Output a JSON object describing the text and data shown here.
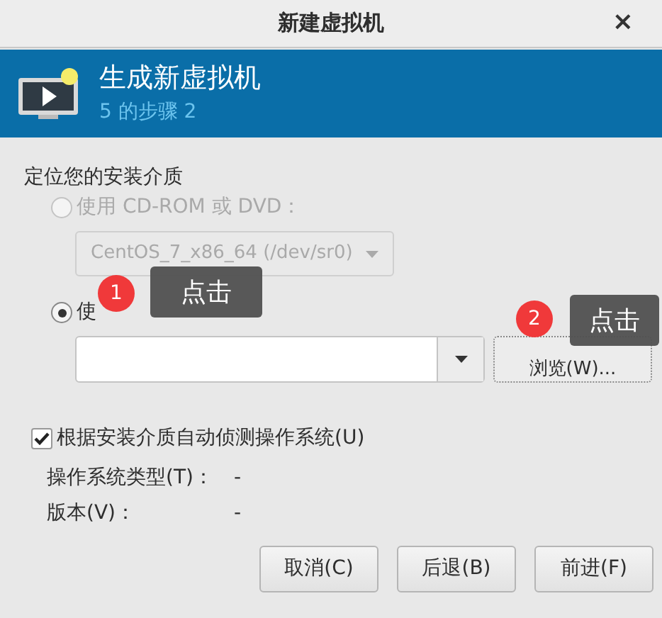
{
  "window": {
    "title": "新建虚拟机",
    "close": "×"
  },
  "header": {
    "title": "生成新虚拟机",
    "subtitle": "5 的步骤 2"
  },
  "section_label": "定位您的安装介质",
  "options": [
    {
      "label": "使用  CD-ROM 或  DVD：",
      "selected": false,
      "disabled": true,
      "kind": "dropdown",
      "value": "CentOS_7_x86_64 (/dev/sr0)"
    },
    {
      "label": "使",
      "selected": true,
      "disabled": false,
      "kind": "combo",
      "button": "浏览(W)..."
    }
  ],
  "autodetect": {
    "label": "根据安装介质自动侦测操作系统(U)",
    "checked": true
  },
  "info": [
    {
      "label": "操作系统类型(T)：",
      "value": "-"
    },
    {
      "label": "版本(V)：",
      "value": "-"
    }
  ],
  "buttons": [
    "取消(C)",
    "后退(B)",
    "前进(F)"
  ],
  "callouts": [
    {
      "number": "1",
      "text": "点击"
    },
    {
      "number": "2",
      "text": "点击"
    }
  ]
}
